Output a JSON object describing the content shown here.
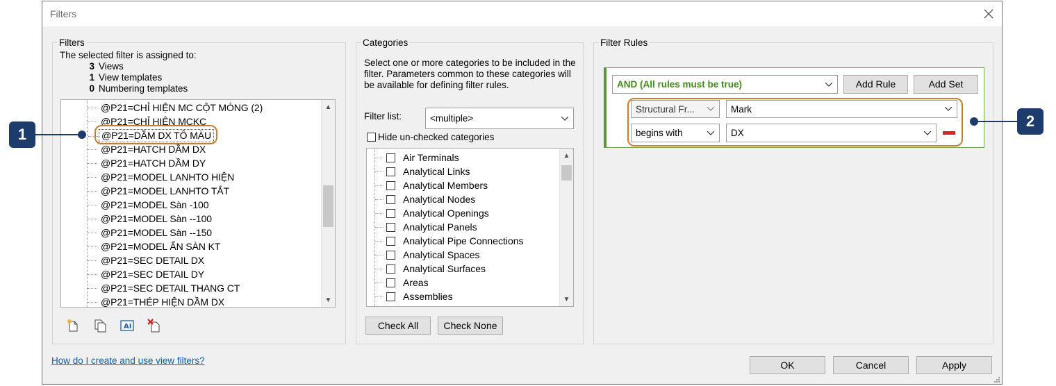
{
  "window": {
    "title": "Filters",
    "close_icon": "close-icon"
  },
  "filters": {
    "label": "Filters",
    "assigned_title": "The selected filter is assigned to:",
    "assigned": [
      {
        "count": "3",
        "label": "Views"
      },
      {
        "count": "1",
        "label": "View templates"
      },
      {
        "count": "0",
        "label": "Numbering templates"
      }
    ],
    "items": [
      "@P21=CHỈ HIỆN MC CỘT MÓNG (2)",
      "@P21=CHỈ HIỆN MCKC",
      "@P21=DẦM DX TÔ MÀU",
      "@P21=HATCH DẦM DX",
      "@P21=HATCH DẦM DY",
      "@P21=MODEL LANHTO HIỆN",
      "@P21=MODEL LANHTO TẮT",
      "@P21=MODEL Sàn -100",
      "@P21=MODEL Sàn --100",
      "@P21=MODEL Sàn --150",
      "@P21=MODEL ẨN SÀN KT",
      "@P21=SEC DETAIL DX",
      "@P21=SEC DETAIL DY",
      "@P21=SEC DETAIL THANG CT",
      "@P21=THÉP  HIỆN  DẦM DX"
    ],
    "selected_index": 2,
    "toolbar_icons": [
      "new-filter-icon",
      "duplicate-filter-icon",
      "rename-filter-icon",
      "delete-filter-icon"
    ]
  },
  "categories": {
    "label": "Categories",
    "description": "Select one or more categories to be included in the filter.  Parameters common to these categories will be available for defining filter rules.",
    "filter_list_label": "Filter list:",
    "filter_list_value": "<multiple>",
    "hide_unchecked_label": "Hide un-checked categories",
    "items": [
      "Air Terminals",
      "Analytical Links",
      "Analytical Members",
      "Analytical Nodes",
      "Analytical Openings",
      "Analytical Panels",
      "Analytical Pipe Connections",
      "Analytical Spaces",
      "Analytical Surfaces",
      "Areas",
      "Assemblies"
    ],
    "check_all_label": "Check All",
    "check_none_label": "Check None"
  },
  "filter_rules": {
    "label": "Filter Rules",
    "logic_value": "AND (All rules must be true)",
    "add_rule_label": "Add Rule",
    "add_set_label": "Add Set",
    "category_value": "Structural Fr...",
    "parameter_value": "Mark",
    "operator_value": "begins with",
    "rule_value": "DX"
  },
  "footer": {
    "help_link": "How do I create and use view filters?",
    "ok_label": "OK",
    "cancel_label": "Cancel",
    "apply_label": "Apply"
  },
  "callouts": [
    "1",
    "2"
  ],
  "colors": {
    "highlight": "#c77f2c",
    "badge": "#1d3c6b",
    "rule_green": "#3f8b1a",
    "link": "#0b5fb0"
  }
}
